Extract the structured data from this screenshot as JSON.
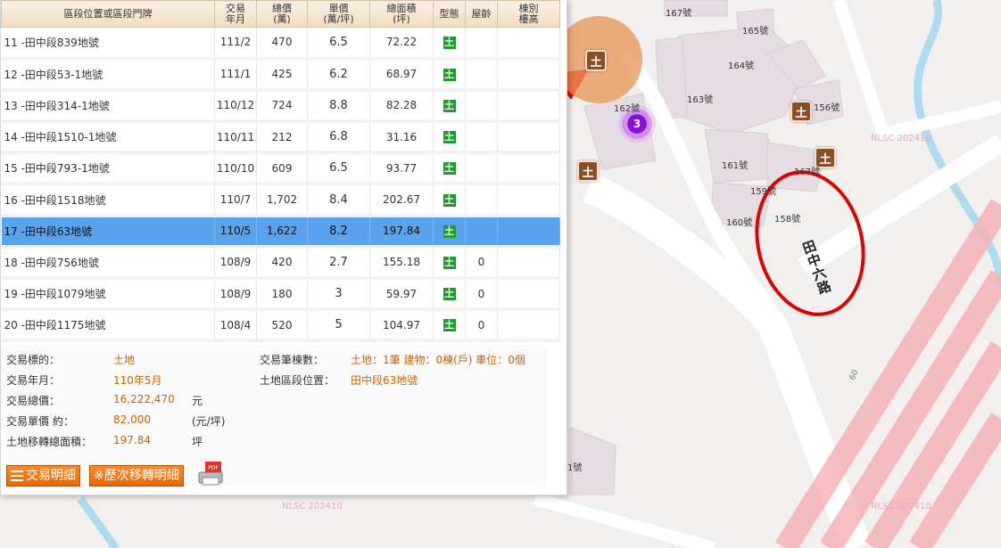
{
  "table": {
    "headers": [
      "區段位置或區段門牌",
      "交易\n年月",
      "總價\n(萬)",
      "單價\n(萬/坪)",
      "總面積\n(坪)",
      "型態",
      "屋齡",
      "棟別\n樓高"
    ],
    "rows": [
      {
        "loc": "11  -田中段839地號",
        "date": "111/2",
        "total": "470",
        "unit": "6.5",
        "area": "72.22",
        "type": "土",
        "age": "",
        "floor": ""
      },
      {
        "loc": "12  -田中段53-1地號",
        "date": "111/1",
        "total": "425",
        "unit": "6.2",
        "area": "68.97",
        "type": "土",
        "age": "",
        "floor": ""
      },
      {
        "loc": "13  -田中段314-1地號",
        "date": "110/12",
        "total": "724",
        "unit": "8.8",
        "area": "82.28",
        "type": "土",
        "age": "",
        "floor": ""
      },
      {
        "loc": "14  -田中段1510-1地號",
        "date": "110/11",
        "total": "212",
        "unit": "6.8",
        "area": "31.16",
        "type": "土",
        "age": "",
        "floor": ""
      },
      {
        "loc": "15  -田中段793-1地號",
        "date": "110/10",
        "total": "609",
        "unit": "6.5",
        "area": "93.77",
        "type": "土",
        "age": "",
        "floor": ""
      },
      {
        "loc": "16  -田中段1518地號",
        "date": "110/7",
        "total": "1,702",
        "unit": "8.4",
        "area": "202.67",
        "type": "土",
        "age": "",
        "floor": ""
      },
      {
        "loc": "17  -田中段63地號",
        "date": "110/5",
        "total": "1,622",
        "unit": "8.2",
        "area": "197.84",
        "type": "土",
        "age": "",
        "floor": "",
        "selected": true
      },
      {
        "loc": "18  -田中段756地號",
        "date": "108/9",
        "total": "420",
        "unit": "2.7",
        "area": "155.18",
        "type": "土",
        "age": "0",
        "floor": ""
      },
      {
        "loc": "19  -田中段1079地號",
        "date": "108/9",
        "total": "180",
        "unit": "3",
        "area": "59.97",
        "type": "土",
        "age": "0",
        "floor": ""
      },
      {
        "loc": "20  -田中段1175地號",
        "date": "108/4",
        "total": "520",
        "unit": "5",
        "area": "104.97",
        "type": "土",
        "age": "0",
        "floor": ""
      }
    ]
  },
  "details": {
    "target_label": "交易標的：",
    "target_value": "土地",
    "date_label": "交易年月：",
    "date_value": "110年5月",
    "total_label": "交易總價：",
    "total_value": "16,222,470",
    "total_unit": "元",
    "unit_label": "交易單價 約：",
    "unit_value": "82,000",
    "unit_unit": "(元/坪)",
    "area_label": "土地移轉總面積：",
    "area_value": "197.84",
    "area_unit": "坪",
    "count_label": "交易筆棟數：",
    "count_value": "土地：1筆 建物：0棟(戶) 車位：0個",
    "location_label": "土地區段位置：",
    "location_value": "田中段63地號"
  },
  "buttons": {
    "detail": "交易明細",
    "history": "※歷次移轉明細",
    "pdf": "PDF"
  },
  "map": {
    "labels": [
      "167號",
      "165號",
      "164號",
      "163號",
      "162號",
      "156號",
      "161號",
      "167號",
      "159號",
      "158號",
      "160號",
      "1號"
    ],
    "watermark": "NLSC 202410",
    "road_name": "田中六路",
    "road_number": "60",
    "cluster_count": "3",
    "marker_symbol": "土"
  },
  "colors": {
    "selected_row": "#5aa3ec",
    "accent_orange": "#e66800",
    "land_type_green": "#1e9b2c",
    "annotation_red": "#e00000"
  }
}
